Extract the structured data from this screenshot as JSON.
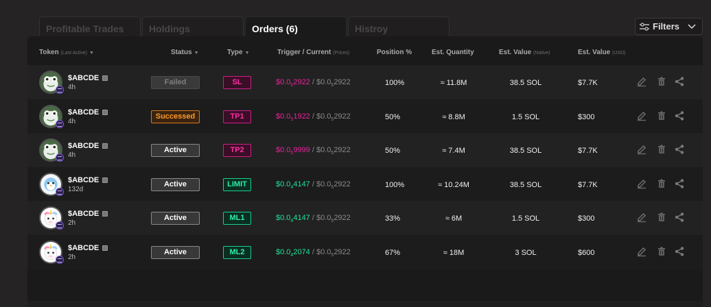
{
  "tabs": [
    {
      "label": "Profitable Trades",
      "active": false
    },
    {
      "label": "Holdings",
      "active": false
    },
    {
      "label": "Orders (6)",
      "active": true
    },
    {
      "label": "Histroy",
      "active": false
    }
  ],
  "filters": {
    "label": "Filters",
    "icon": "sliders-icon"
  },
  "columns": {
    "token": "Token",
    "token_sub": "(Last Active)",
    "status": "Status",
    "type": "Type",
    "trigger": "Trigger / Current",
    "trigger_sub": "(Prices)",
    "position": "Position %",
    "quantity": "Est. Quantity",
    "value_native": "Est. Value",
    "value_native_sub": "(Native)",
    "value_usd": "Est. Value",
    "value_usd_sub": "(USD)"
  },
  "colors": {
    "pink": "#e9239c",
    "green": "#22e29a",
    "success_orange": "#ff9a2a"
  },
  "rows": [
    {
      "name": "$ABCDE",
      "age": "4h",
      "status": "Failed",
      "status_kind": "failed",
      "type": "SL",
      "type_color": "pink",
      "trigger_pre": "$0.0",
      "trigger_sub": "5",
      "trigger_post": "2922",
      "trigger_color": "pink",
      "current_pre": "$0.0",
      "current_sub": "5",
      "current_post": "2922",
      "position": "100%",
      "quantity": "≈ 11.8M",
      "value_native": "38.5 SOL",
      "value_usd": "$7.7K",
      "avatar": "frog"
    },
    {
      "name": "$ABCDE",
      "age": "4h",
      "status": "Successed",
      "status_kind": "success",
      "type": "TP1",
      "type_color": "pink",
      "trigger_pre": "$0.0",
      "trigger_sub": "5",
      "trigger_post": "1922",
      "trigger_color": "pink",
      "current_pre": "$0.0",
      "current_sub": "5",
      "current_post": "2922",
      "position": "50%",
      "quantity": "≈ 8.8M",
      "value_native": "1.5 SOL",
      "value_usd": "$300",
      "avatar": "frog"
    },
    {
      "name": "$ABCDE",
      "age": "4h",
      "status": "Active",
      "status_kind": "active",
      "type": "TP2",
      "type_color": "pink",
      "trigger_pre": "$0.0",
      "trigger_sub": "5",
      "trigger_post": "9999",
      "trigger_color": "pink",
      "current_pre": "$0.0",
      "current_sub": "5",
      "current_post": "2922",
      "position": "50%",
      "quantity": "≈ 7.4M",
      "value_native": "38.5 SOL",
      "value_usd": "$7.7K",
      "avatar": "frog"
    },
    {
      "name": "$ABCDE",
      "age": "132d",
      "status": "Active",
      "status_kind": "active",
      "type": "LIMIT",
      "type_color": "green",
      "trigger_pre": "$0.0",
      "trigger_sub": "4",
      "trigger_post": "4147",
      "trigger_color": "green",
      "current_pre": "$0.0",
      "current_sub": "5",
      "current_post": "2922",
      "position": "100%",
      "quantity": "≈ 10.24M",
      "value_native": "38.5 SOL",
      "value_usd": "$7.7K",
      "avatar": "penguin"
    },
    {
      "name": "$ABCDE",
      "age": "2h",
      "status": "Active",
      "status_kind": "active",
      "type": "ML1",
      "type_color": "green",
      "trigger_pre": "$0.0",
      "trigger_sub": "4",
      "trigger_post": "4147",
      "trigger_color": "green",
      "current_pre": "$0.0",
      "current_sub": "5",
      "current_post": "2922",
      "position": "33%",
      "quantity": "≈ 6M",
      "value_native": "1.5 SOL",
      "value_usd": "$300",
      "avatar": "unicorn"
    },
    {
      "name": "$ABCDE",
      "age": "2h",
      "status": "Active",
      "status_kind": "active",
      "type": "ML2",
      "type_color": "green",
      "trigger_pre": "$0.0",
      "trigger_sub": "4",
      "trigger_post": "2074",
      "trigger_color": "green",
      "current_pre": "$0.0",
      "current_sub": "5",
      "current_post": "2922",
      "position": "67%",
      "quantity": "≈ 18M",
      "value_native": "3 SOL",
      "value_usd": "$600",
      "avatar": "unicorn"
    }
  ],
  "row_actions": [
    "edit-icon",
    "trash-icon",
    "share-icon"
  ]
}
